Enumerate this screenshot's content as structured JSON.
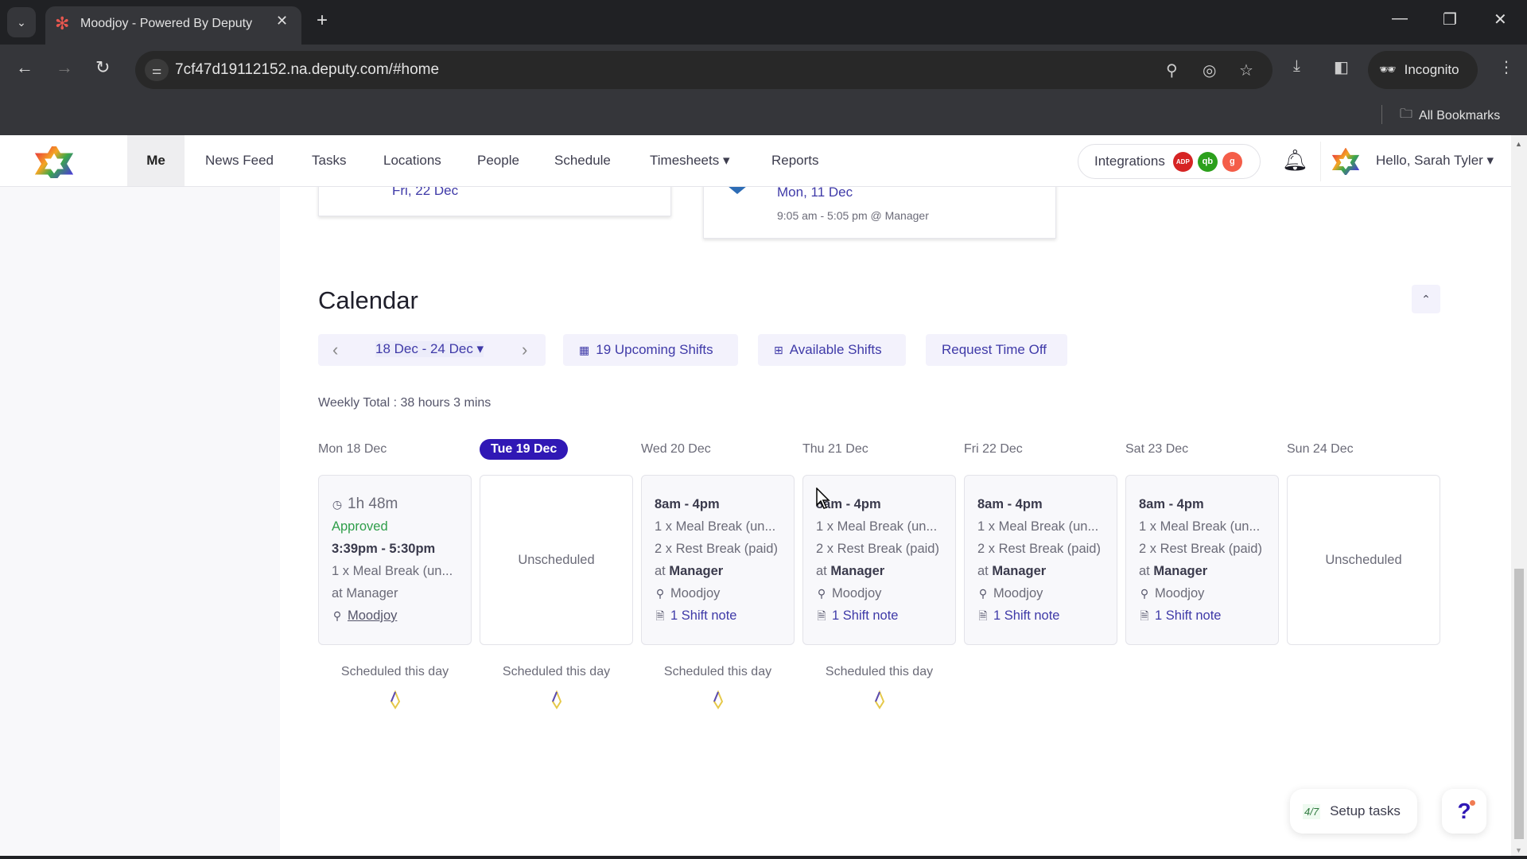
{
  "browser": {
    "tab_title": "Moodjoy - Powered By Deputy",
    "url": "7cf47d19112152.na.deputy.com/#home",
    "incognito_label": "Incognito",
    "bookmarks_label": "All Bookmarks",
    "new_tab_glyph": "+",
    "tab_close_glyph": "✕"
  },
  "nav": {
    "items": [
      {
        "label": "Me",
        "active": true
      },
      {
        "label": "News Feed"
      },
      {
        "label": "Tasks"
      },
      {
        "label": "Locations"
      },
      {
        "label": "People"
      },
      {
        "label": "Schedule"
      },
      {
        "label": "Timesheets ▾"
      },
      {
        "label": "Reports"
      }
    ],
    "integrations_label": "Integrations",
    "integrations": [
      {
        "name": "ADP",
        "glyph": "ADP",
        "color": "#d62424"
      },
      {
        "name": "QuickBooks",
        "glyph": "qb",
        "color": "#2ca01c"
      },
      {
        "name": "Gusto",
        "glyph": "g",
        "color": "#f45d48"
      }
    ],
    "greeting": "Hello, Sarah Tyler ▾"
  },
  "upper_cards": [
    {
      "date": "Fri, 22 Dec",
      "icon_color": "#f07b3f"
    },
    {
      "date": "Mon, 11 Dec",
      "detail": "9:05 am - 5:05 pm @ Manager",
      "icon_color": "#2d6cb5"
    }
  ],
  "calendar": {
    "title": "Calendar",
    "collapse_glyph": "⌃",
    "range_label": "18 Dec - 24 Dec ▾",
    "prev_glyph": "‹",
    "next_glyph": "›",
    "upcoming_label": "19 Upcoming Shifts",
    "available_label": "Available Shifts",
    "request_off_label": "Request Time Off",
    "weekly_total": "Weekly Total : 38 hours 3 mins",
    "days": [
      {
        "header": "Mon 18 Dec",
        "type": "timesheet",
        "duration": "1h 48m",
        "status": "Approved",
        "time": "3:39pm - 5:30pm",
        "break1": "1 x Meal Break (un...",
        "at": "at Manager",
        "location": "Moodjoy",
        "scheduled_label": "Scheduled this day"
      },
      {
        "header": "Tue 19 Dec",
        "today": true,
        "type": "unscheduled",
        "label": "Unscheduled",
        "scheduled_label": "Scheduled this day"
      },
      {
        "header": "Wed 20 Dec",
        "type": "shift",
        "time": "8am - 4pm",
        "break1": "1 x Meal Break (un...",
        "break2": "2 x Rest Break (paid)",
        "at_prefix": "at ",
        "area": "Manager",
        "location": "Moodjoy",
        "note": "1 Shift note",
        "scheduled_label": "Scheduled this day"
      },
      {
        "header": "Thu 21 Dec",
        "type": "shift",
        "time": "8am - 4pm",
        "break1": "1 x Meal Break (un...",
        "break2": "2 x Rest Break (paid)",
        "at_prefix": "at ",
        "area": "Manager",
        "location": "Moodjoy",
        "note": "1 Shift note",
        "scheduled_label": "Scheduled this day"
      },
      {
        "header": "Fri 22 Dec",
        "type": "shift",
        "time": "8am - 4pm",
        "break1": "1 x Meal Break (un...",
        "break2": "2 x Rest Break (paid)",
        "at_prefix": "at ",
        "area": "Manager",
        "location": "Moodjoy",
        "note": "1 Shift note"
      },
      {
        "header": "Sat 23 Dec",
        "type": "shift",
        "time": "8am - 4pm",
        "break1": "1 x Meal Break (un...",
        "break2": "2 x Rest Break (paid)",
        "at_prefix": "at ",
        "area": "Manager",
        "location": "Moodjoy",
        "note": "1 Shift note"
      },
      {
        "header": "Sun 24 Dec",
        "type": "unscheduled",
        "label": "Unscheduled"
      }
    ]
  },
  "setup": {
    "count": "4/7",
    "label": "Setup tasks"
  },
  "help_glyph": "?",
  "colors": {
    "accent": "#3018b5",
    "link": "#3f3aa8",
    "approved": "#2f9e4a"
  }
}
